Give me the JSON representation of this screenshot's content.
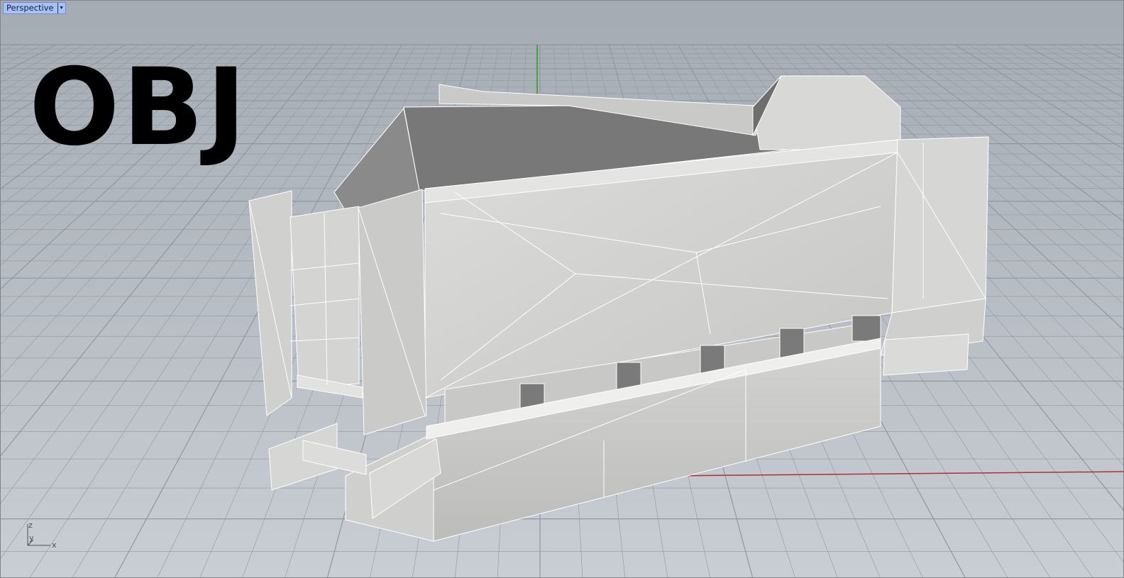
{
  "viewport": {
    "name": "Perspective",
    "menu_icon": "triangle-down-icon"
  },
  "overlay_text": "OBJ",
  "axes": {
    "x": "x",
    "y": "y",
    "z": "z"
  },
  "colors": {
    "background_top": "#a5abb3",
    "background_bottom": "#c5cad1",
    "grid_line": "#8f979f",
    "x_axis": "#b03030",
    "y_axis": "#2a9a2a",
    "model_face": "#d2d2d0",
    "model_shadow": "#7a7a7a",
    "model_edge": "#ffffff"
  }
}
